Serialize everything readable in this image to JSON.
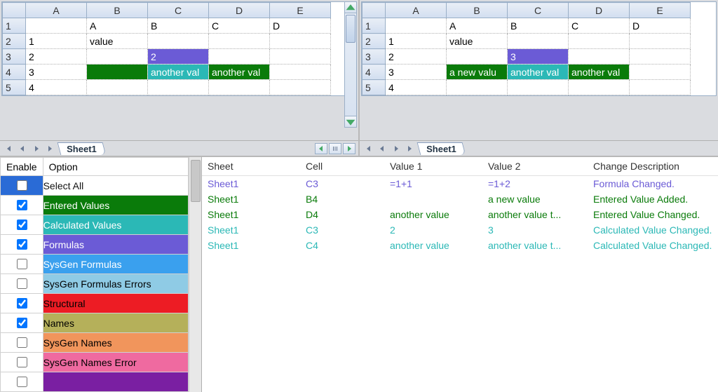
{
  "columns": [
    "A",
    "B",
    "C",
    "D",
    "E"
  ],
  "left_sheet": {
    "tab": "Sheet1",
    "rows": [
      {
        "r": "1",
        "A": "",
        "B": "A",
        "C": "B",
        "D": "C",
        "E": "D"
      },
      {
        "r": "2",
        "A": "1",
        "B": "value",
        "C": "",
        "D": "",
        "E": ""
      },
      {
        "r": "3",
        "A": "2",
        "B": "",
        "C": "2",
        "D": "",
        "E": ""
      },
      {
        "r": "4",
        "A": "3",
        "B": "",
        "C": "another val",
        "D": "another val",
        "E": ""
      },
      {
        "r": "5",
        "A": "4",
        "B": "",
        "C": "",
        "D": "",
        "E": ""
      }
    ]
  },
  "right_sheet": {
    "tab": "Sheet1",
    "rows": [
      {
        "r": "1",
        "A": "",
        "B": "A",
        "C": "B",
        "D": "C",
        "E": "D"
      },
      {
        "r": "2",
        "A": "1",
        "B": "value",
        "C": "",
        "D": "",
        "E": ""
      },
      {
        "r": "3",
        "A": "2",
        "B": "",
        "C": "3",
        "D": "",
        "E": ""
      },
      {
        "r": "4",
        "A": "3",
        "B": "a new valu",
        "C": "another val",
        "D": "another val",
        "E": ""
      },
      {
        "r": "5",
        "A": "4",
        "B": "",
        "C": "",
        "D": "",
        "E": ""
      }
    ]
  },
  "options": {
    "headers": {
      "enable": "Enable",
      "option": "Option"
    },
    "rows": [
      {
        "id": "select-all",
        "label": "Select All",
        "checked": false,
        "bgClass": "",
        "special": "select-all"
      },
      {
        "id": "entered",
        "label": "Entered Values",
        "checked": true,
        "bgClass": "bg-entered"
      },
      {
        "id": "calc",
        "label": "Calculated Values",
        "checked": true,
        "bgClass": "bg-calc"
      },
      {
        "id": "formulas",
        "label": "Formulas",
        "checked": true,
        "bgClass": "bg-formula"
      },
      {
        "id": "sysgenf",
        "label": "SysGen Formulas",
        "checked": false,
        "bgClass": "bg-sysgenf"
      },
      {
        "id": "sysgenfe",
        "label": "SysGen Formulas Errors",
        "checked": false,
        "bgClass": "bg-sysgenfe"
      },
      {
        "id": "struct",
        "label": "Structural",
        "checked": true,
        "bgClass": "bg-struct"
      },
      {
        "id": "names",
        "label": "Names",
        "checked": true,
        "bgClass": "bg-names"
      },
      {
        "id": "sysgenn",
        "label": "SysGen Names",
        "checked": false,
        "bgClass": "bg-sysgenn"
      },
      {
        "id": "sysgenne",
        "label": "SysGen Names Error",
        "checked": false,
        "bgClass": "bg-sysgenne"
      },
      {
        "id": "hidden-last",
        "label": "",
        "checked": false,
        "bgClass": "bg-purple"
      }
    ]
  },
  "changes": {
    "headers": {
      "sheet": "Sheet",
      "cell": "Cell",
      "v1": "Value 1",
      "v2": "Value 2",
      "desc": "Change Description"
    },
    "rows": [
      {
        "sheet": "Sheet1",
        "cell": "C3",
        "v1": "=1+1",
        "v2": "=1+2",
        "desc": "Formula Changed.",
        "cls": "c-formula"
      },
      {
        "sheet": "Sheet1",
        "cell": "B4",
        "v1": "",
        "v2": "a new value",
        "desc": "Entered Value Added.",
        "cls": "c-green"
      },
      {
        "sheet": "Sheet1",
        "cell": "D4",
        "v1": "another value",
        "v2": "another value t...",
        "desc": "Entered Value Changed.",
        "cls": "c-green"
      },
      {
        "sheet": "Sheet1",
        "cell": "C3",
        "v1": "2",
        "v2": "3",
        "desc": "Calculated Value Changed.",
        "cls": "c-calc"
      },
      {
        "sheet": "Sheet1",
        "cell": "C4",
        "v1": "another value",
        "v2": "another value t...",
        "desc": "Calculated Value Changed.",
        "cls": "c-calc"
      }
    ]
  },
  "cell_highlights": {
    "left": {
      "3.C": "hl-formula",
      "4.B": "hl-green",
      "4.C": "hl-calc",
      "4.D": "hl-green"
    },
    "right": {
      "3.C": "hl-formula",
      "4.B": "hl-green",
      "4.C": "hl-calc",
      "4.D": "hl-green"
    }
  }
}
